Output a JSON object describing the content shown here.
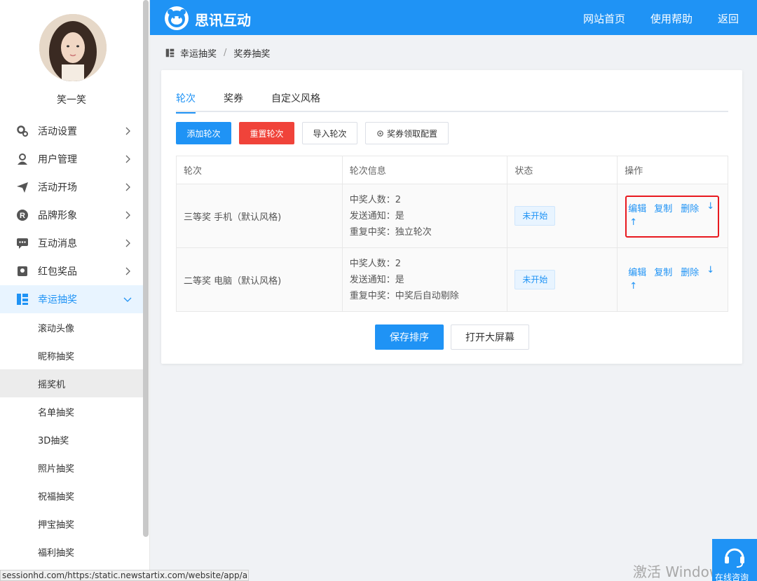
{
  "app": {
    "brand": "思讯互动"
  },
  "header": {
    "links": [
      "网站首页",
      "使用帮助",
      "返回"
    ]
  },
  "user": {
    "name": "笑一笑"
  },
  "sidebar": {
    "items": [
      {
        "label": "活动设置",
        "icon": "gear-icon"
      },
      {
        "label": "用户管理",
        "icon": "user-icon"
      },
      {
        "label": "活动开场",
        "icon": "send-icon"
      },
      {
        "label": "品牌形象",
        "icon": "registered-icon"
      },
      {
        "label": "互动消息",
        "icon": "chat-icon"
      },
      {
        "label": "红包奖品",
        "icon": "redpacket-icon"
      },
      {
        "label": "幸运抽奖",
        "icon": "lottery-icon",
        "active": true
      }
    ],
    "subitems": [
      "滚动头像",
      "昵称抽奖",
      "摇奖机",
      "名单抽奖",
      "3D抽奖",
      "照片抽奖",
      "祝福抽奖",
      "押宝抽奖",
      "福利抽奖"
    ],
    "selected_sub": "摇奖机"
  },
  "breadcrumb": {
    "parent": "幸运抽奖",
    "sep": "/",
    "current": "奖券抽奖"
  },
  "tabs": [
    "轮次",
    "奖券",
    "自定义风格"
  ],
  "toolbar": {
    "add": "添加轮次",
    "reset": "重置轮次",
    "import": "导入轮次",
    "config": "奖券领取配置"
  },
  "table": {
    "headers": [
      "轮次",
      "轮次信息",
      "状态",
      "操作"
    ],
    "rows": [
      {
        "name": "三等奖 手机（默认风格)",
        "info": [
          "中奖人数：2",
          "发送通知：是",
          "重复中奖：独立轮次"
        ],
        "status": "未开始",
        "ops": [
          "编辑",
          "复制",
          "删除",
          "↓",
          "↑"
        ]
      },
      {
        "name": "二等奖 电脑（默认风格)",
        "info": [
          "中奖人数：2",
          "发送通知：是",
          "重复中奖：中奖后自动剔除"
        ],
        "status": "未开始",
        "ops": [
          "编辑",
          "复制",
          "删除",
          "↓",
          "↑"
        ]
      }
    ]
  },
  "footer_buttons": {
    "save": "保存排序",
    "open": "打开大屏幕"
  },
  "statusbar": {
    "url": "sessionhd.com/https:/static.newstartix.com/website/app/a"
  },
  "watermark": "激活 Windows",
  "online": {
    "label": "在线咨询"
  },
  "colors": {
    "primary": "#1f93f5",
    "danger": "#f0433a",
    "highlight": "#e8191f"
  }
}
